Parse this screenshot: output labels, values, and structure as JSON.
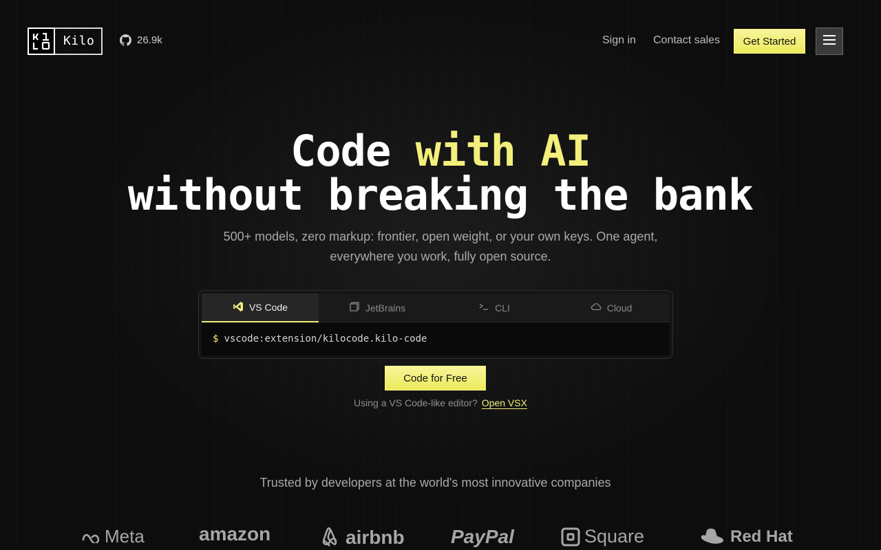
{
  "nav": {
    "brand": "Kilo",
    "github_stars": "26.9k",
    "sign_in": "Sign in",
    "contact_sales": "Contact sales",
    "get_started": "Get Started"
  },
  "hero": {
    "title_part1": "Code ",
    "title_highlight": "with AI",
    "title_line2": "without breaking the bank",
    "subtitle": "500+ models, zero markup: frontier, open weight, or your own keys. One agent, everywhere you work, fully open source."
  },
  "install": {
    "tabs": [
      {
        "label": "VS Code",
        "icon": "vscode-icon",
        "active": true
      },
      {
        "label": "JetBrains",
        "icon": "jetbrains-icon",
        "active": false
      },
      {
        "label": "CLI",
        "icon": "terminal-icon",
        "active": false
      },
      {
        "label": "Cloud",
        "icon": "cloud-icon",
        "active": false
      }
    ],
    "prompt": "$",
    "command": "vscode:extension/kilocode.kilo-code"
  },
  "cta": {
    "label": "Code for Free",
    "vsx_prefix": "Using a VS Code-like editor?",
    "vsx_link": "Open VSX"
  },
  "trusted": {
    "heading": "Trusted by developers at the world's most innovative companies",
    "companies": [
      "Meta",
      "amazon",
      "airbnb",
      "PayPal",
      "Square",
      "Red Hat"
    ]
  },
  "colors": {
    "accent": "#f3ef7c",
    "background": "#0d0d0d"
  }
}
